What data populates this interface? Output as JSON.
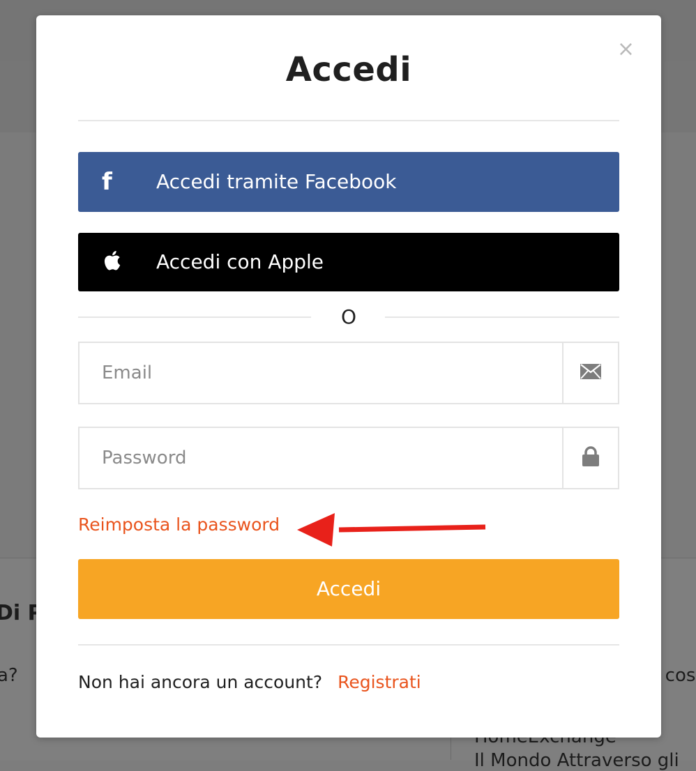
{
  "background": {
    "left_heading_fragment": "Di P",
    "left_question_fragment": "a?",
    "right_text_fragment": "y cos",
    "bottom_text_1": "HomeExchange",
    "bottom_text_2": "Il Mondo Attraverso gli"
  },
  "modal": {
    "title": "Accedi",
    "close_symbol": "×",
    "facebook_button": "Accedi tramite Facebook",
    "facebook_icon_glyph": "f",
    "apple_button": "Accedi con Apple",
    "separator": "O",
    "email_placeholder": "Email",
    "password_placeholder": "Password",
    "reset_password_link": "Reimposta la password",
    "submit_button": "Accedi",
    "no_account_text": "Non hai ancora un account?",
    "register_link": "Registrati"
  },
  "colors": {
    "facebook": "#3b5b95",
    "apple": "#000000",
    "submit": "#f7a524",
    "link": "#e9541d",
    "annotation_arrow": "#e8211a"
  },
  "icons": [
    "close-icon",
    "facebook-icon",
    "apple-icon",
    "envelope-icon",
    "lock-icon",
    "annotation-arrow",
    "dollar-icon"
  ]
}
